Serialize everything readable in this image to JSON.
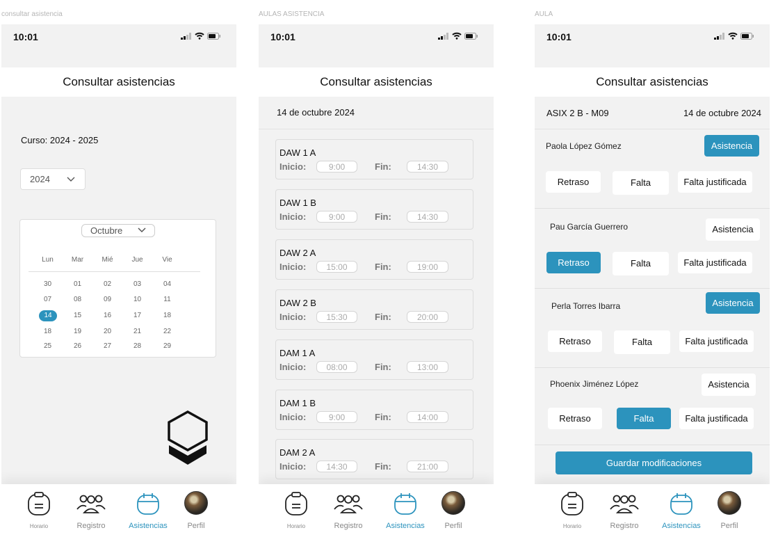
{
  "frames": [
    {
      "label": "consultar asistencia"
    },
    {
      "label": "AULAS ASISTENCIA"
    },
    {
      "label": "AULA"
    }
  ],
  "status": {
    "time": "10:01"
  },
  "header": {
    "title": "Consultar asistencias"
  },
  "tabs": [
    {
      "label": "Horario",
      "icon": "clipboard-icon"
    },
    {
      "label": "Registro",
      "icon": "users-icon"
    },
    {
      "label": "Asistencias",
      "icon": "calendar-icon",
      "active": true
    },
    {
      "label": "Perfil",
      "icon": "avatar"
    }
  ],
  "screen1": {
    "curso": "Curso: 2024 - 2025",
    "year": "2024",
    "month": "Octubre",
    "weekdays": [
      "Lun",
      "Mar",
      "Mié",
      "Jue",
      "Vie"
    ],
    "weeks": [
      [
        "30",
        "01",
        "02",
        "03",
        "04"
      ],
      [
        "07",
        "08",
        "09",
        "10",
        "11"
      ],
      [
        "14",
        "15",
        "16",
        "17",
        "18"
      ],
      [
        "18",
        "19",
        "20",
        "21",
        "22"
      ],
      [
        "25",
        "26",
        "27",
        "28",
        "29"
      ]
    ],
    "selected_day": "14"
  },
  "screen2": {
    "date": "14 de octubre 2024",
    "start_label": "Inicio:",
    "end_label": "Fin:",
    "classes": [
      {
        "name": "DAW 1  A",
        "start": "9:00",
        "end": "14:30"
      },
      {
        "name": "DAW 1  B",
        "start": "9:00",
        "end": "14:30"
      },
      {
        "name": "DAW 2 A",
        "start": "15:00",
        "end": "19:00"
      },
      {
        "name": "DAW 2 B",
        "start": "15:30",
        "end": "20:00"
      },
      {
        "name": "DAM 1 A",
        "start": "08:00",
        "end": "13:00"
      },
      {
        "name": "DAM 1 B",
        "start": "9:00",
        "end": "14:00"
      },
      {
        "name": "DAM 2 A",
        "start": "14:30",
        "end": "21:00"
      }
    ]
  },
  "screen3": {
    "group": "ASIX 2 B - M09",
    "date": "14 de octubre 2024",
    "labels": {
      "asistencia": "Asistencia",
      "retraso": "Retraso",
      "falta": "Falta",
      "justificada": "Falta justificada"
    },
    "students": [
      {
        "name": "Paola López Gómez",
        "status": "asistencia"
      },
      {
        "name": "Pau García Guerrero",
        "status": "retraso"
      },
      {
        "name": "Perla Torres Ibarra",
        "status": "asistencia"
      },
      {
        "name": "Phoenix  Jiménez López",
        "status": "falta"
      }
    ],
    "save": "Guardar modificaciones"
  },
  "colors": {
    "accent": "#2c93bd",
    "background": "#f2f2f2"
  }
}
